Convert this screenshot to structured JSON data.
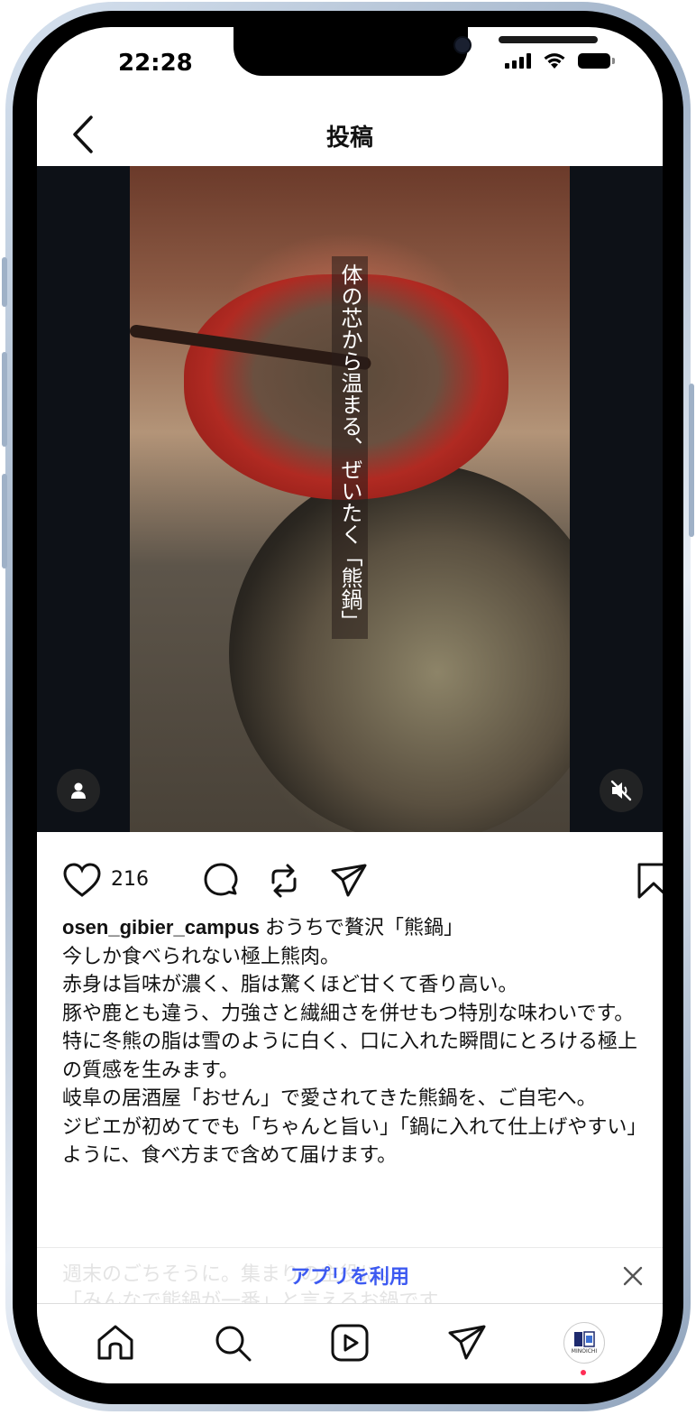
{
  "status_bar": {
    "time": "22:28"
  },
  "nav": {
    "title": "投稿",
    "back_icon": "chevron-left-icon"
  },
  "post": {
    "overlay_text": "体の芯から温まる、ぜいたく「熊鍋」",
    "likes": "216",
    "username": "osen_gibier_campus",
    "caption_lines": [
      "おうちで贅沢「熊鍋」",
      "今しか食べられない極上熊肉。",
      "赤身は旨味が濃く、脂は驚くほど甘くて香り高い。",
      "豚や鹿とも違う、力強さと繊細さを併せもつ特別な味わいです。",
      "特に冬熊の脂は雪のように白く、口に入れた瞬間にとろける極上の質感を生みます。",
      "岐阜の居酒屋「おせん」で愛されてきた熊鍋を、ご自宅へ。",
      "ジビエが初めてでも「ちゃんと旨い」「鍋に入れて仕上げやすい」ように、食べ方まで含めて届けます。"
    ],
    "faded_lines": [
      "週末のごちそうに。集まりの主役に。",
      "「みんなで熊鍋が一番」と言えるお鍋です"
    ]
  },
  "banner": {
    "app_link": "アプリを利用",
    "close_icon": "close-icon"
  },
  "tab_bar": {
    "items": [
      "home-icon",
      "search-icon",
      "reels-icon",
      "direct-message-icon",
      "profile-avatar"
    ],
    "profile_logo": "MINOICHI"
  },
  "colors": {
    "accent": "#3d5af1",
    "notification": "#ff2d55",
    "media_bg": "#0d1117"
  }
}
